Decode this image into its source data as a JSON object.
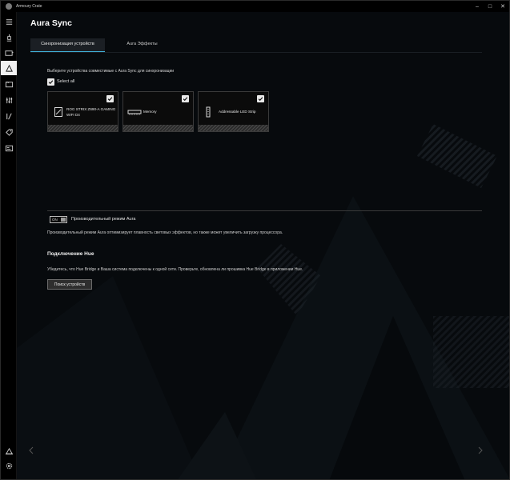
{
  "window": {
    "app_title": "Armoury Crate",
    "controls": [
      "–",
      "□",
      "✕"
    ]
  },
  "rail": {
    "items": [
      {
        "icon": "menu-icon"
      },
      {
        "icon": "trophy-icon"
      },
      {
        "icon": "device-icon"
      },
      {
        "icon": "aura-icon"
      },
      {
        "icon": "folder-icon"
      },
      {
        "icon": "tuning-icon"
      },
      {
        "icon": "tools-icon"
      },
      {
        "icon": "tag-icon"
      },
      {
        "icon": "news-icon"
      },
      {
        "icon": "user-icon"
      },
      {
        "icon": "settings-icon"
      }
    ]
  },
  "page": {
    "title": "Aura Sync"
  },
  "tabs": [
    {
      "label": "Синхронизация устройств",
      "active": true
    },
    {
      "label": "Aura Эффекты",
      "active": false
    }
  ],
  "sync": {
    "instruction": "Выберите устройства совместимые с Aura Sync для синхронизации",
    "select_all_label": "Select all",
    "select_all_checked": true,
    "devices": [
      {
        "name": "ROG STRIX Z690-A GAMING WIFI D4",
        "icon": "motherboard-icon",
        "checked": true
      },
      {
        "name": "Memory",
        "icon": "memory-icon",
        "checked": true
      },
      {
        "name": "Addressable LED Strip",
        "icon": "led-strip-icon",
        "checked": true
      }
    ]
  },
  "performance": {
    "toggle_text": "ON",
    "label": "Производительный режим Aura",
    "description": "Производительный режим Aura оптимизирует плавность световых эффектов, но также может увеличить загрузку процессора."
  },
  "hue": {
    "title": "Подключение Hue",
    "description": "Убедитесь, что Hue Bridge и Ваша система подключены к одной сети. Проверьте, обновлена ли прошивка Hue Bridge в приложении Hue.",
    "button_label": "Поиск устройств"
  },
  "colors": {
    "accent": "#3fb0d7",
    "background": "#070a0d",
    "card_border": "#3a3a3a"
  }
}
